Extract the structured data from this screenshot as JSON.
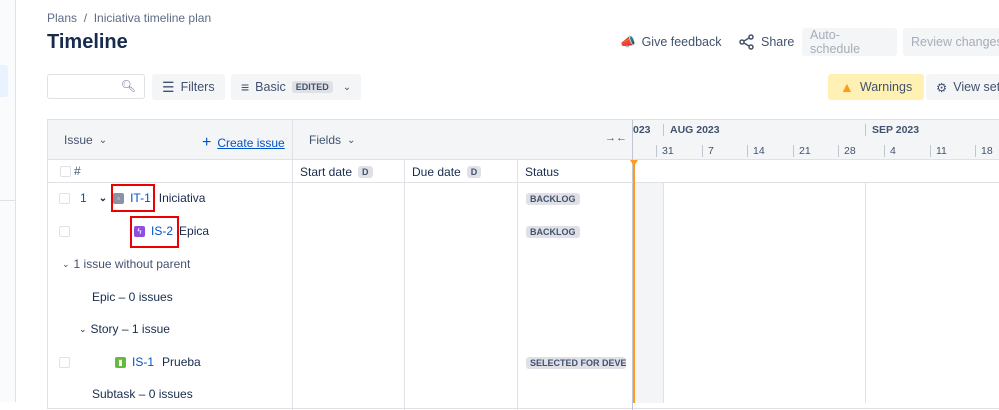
{
  "breadcrumb": {
    "root": "Plans",
    "separator": "/",
    "current": "Iniciativa timeline plan"
  },
  "page_title": "Timeline",
  "header_actions": {
    "feedback": "Give feedback",
    "share": "Share",
    "auto_schedule": "Auto-schedule",
    "review_changes": "Review changes"
  },
  "toolbar": {
    "search_placeholder": "",
    "filters": "Filters",
    "view": "Basic",
    "view_badge": "EDITED",
    "warnings": "Warnings",
    "view_settings": "View settings"
  },
  "table": {
    "issue_header": "Issue",
    "create_issue": "Create issue",
    "fields_header": "Fields",
    "hash": "#",
    "columns": [
      {
        "label": "Start date",
        "badge": "D"
      },
      {
        "label": "Due date",
        "badge": "D"
      },
      {
        "label": "Status"
      }
    ],
    "rows": [
      {
        "num": "1",
        "key": "IT-1",
        "summary": "Iniciativa",
        "status": "BACKLOG",
        "type": "initiative"
      },
      {
        "key": "IS-2",
        "summary": "Epica",
        "status": "BACKLOG",
        "type": "epic"
      },
      {
        "group": "1 issue without parent"
      },
      {
        "group": "Epic – 0 issues"
      },
      {
        "group": "Story – 1 issue"
      },
      {
        "key": "IS-1",
        "summary": "Prueba",
        "status": "SELECTED FOR DEVELOPMENT",
        "type": "story"
      },
      {
        "group": "Subtask – 0 issues"
      }
    ]
  },
  "timeline": {
    "months": [
      "023",
      "AUG 2023",
      "SEP 2023"
    ],
    "weeks": [
      "31",
      "7",
      "14",
      "21",
      "28",
      "4",
      "11",
      "18"
    ]
  },
  "colors": {
    "accent": "#0052cc",
    "today": "#ff991f",
    "warning_bg": "#fff0b3",
    "highlight": "#e00000"
  }
}
